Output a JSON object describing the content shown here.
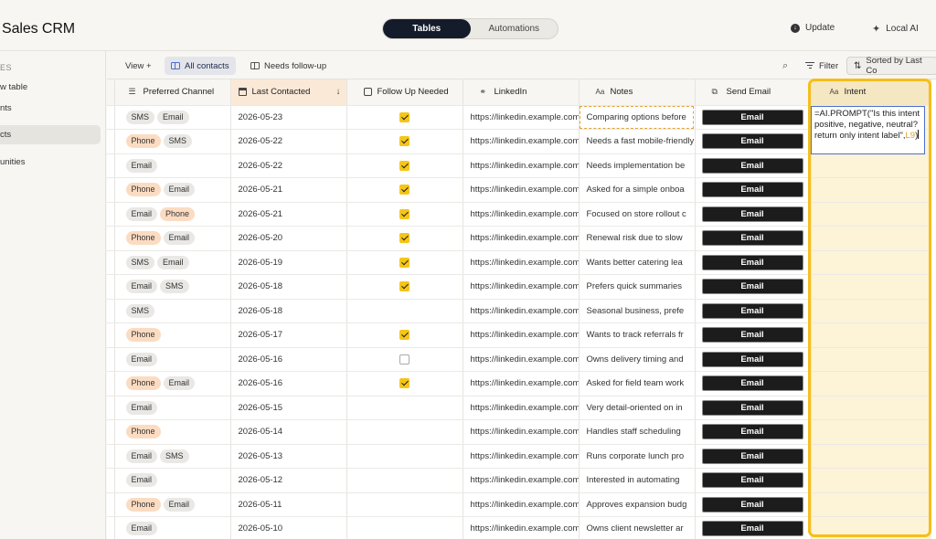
{
  "app": {
    "title": "Sales CRM"
  },
  "top": {
    "tabs": [
      "Tables",
      "Automations"
    ],
    "update_label": "Update",
    "local_ai_label": "Local AI"
  },
  "sidebar": {
    "section": "ES",
    "items": [
      {
        "label": "w table"
      },
      {
        "label": "nts"
      },
      {
        "label": "cts",
        "active": true
      },
      {
        "label": "unities"
      }
    ]
  },
  "toolbar": {
    "view_label": "View +",
    "all_contacts_label": "All contacts",
    "needs_followup_label": "Needs follow-up",
    "filter_label": "Filter",
    "sort_label": "Sorted by Last Co"
  },
  "columns": {
    "preferred_channel": "Preferred Channel",
    "last_contacted": "Last Contacted",
    "follow_up": "Follow Up Needed",
    "linkedin": "LinkedIn",
    "notes": "Notes",
    "send_email": "Send Email",
    "intent": "Intent"
  },
  "formula": {
    "text": "=AI.PROMPT(\"Is this intent positive, negative, neutral? return only intent label\",",
    "ref": "L9",
    "close": ")"
  },
  "email_label": "Email",
  "rows": [
    {
      "channels": [
        "SMS",
        "Email"
      ],
      "date": "2026-05-23",
      "follow": true,
      "linkedin": "https://linkedin.example.com",
      "notes": "Comparing options before"
    },
    {
      "channels": [
        "Phone",
        "SMS"
      ],
      "date": "2026-05-22",
      "follow": true,
      "linkedin": "https://linkedin.example.com",
      "notes": "Needs a fast mobile-friendly"
    },
    {
      "channels": [
        "Email"
      ],
      "date": "2026-05-22",
      "follow": true,
      "linkedin": "https://linkedin.example.com",
      "notes": "Needs implementation be"
    },
    {
      "channels": [
        "Phone",
        "Email"
      ],
      "date": "2026-05-21",
      "follow": true,
      "linkedin": "https://linkedin.example.com",
      "notes": "Asked for a simple onboa"
    },
    {
      "channels": [
        "Email",
        "Phone"
      ],
      "date": "2026-05-21",
      "follow": true,
      "linkedin": "https://linkedin.example.com",
      "notes": "Focused on store rollout c"
    },
    {
      "channels": [
        "Phone",
        "Email"
      ],
      "date": "2026-05-20",
      "follow": true,
      "linkedin": "https://linkedin.example.com",
      "notes": "Renewal risk due to slow"
    },
    {
      "channels": [
        "SMS",
        "Email"
      ],
      "date": "2026-05-19",
      "follow": true,
      "linkedin": "https://linkedin.example.com",
      "notes": "Wants better catering lea"
    },
    {
      "channels": [
        "Email",
        "SMS"
      ],
      "date": "2026-05-18",
      "follow": true,
      "linkedin": "https://linkedin.example.com",
      "notes": "Prefers quick summaries"
    },
    {
      "channels": [
        "SMS"
      ],
      "date": "2026-05-18",
      "follow": null,
      "linkedin": "https://linkedin.example.com",
      "notes": "Seasonal business, prefe"
    },
    {
      "channels": [
        "Phone"
      ],
      "date": "2026-05-17",
      "follow": true,
      "linkedin": "https://linkedin.example.com",
      "notes": "Wants to track referrals fr"
    },
    {
      "channels": [
        "Email"
      ],
      "date": "2026-05-16",
      "follow": false,
      "linkedin": "https://linkedin.example.com",
      "notes": "Owns delivery timing and"
    },
    {
      "channels": [
        "Phone",
        "Email"
      ],
      "date": "2026-05-16",
      "follow": true,
      "linkedin": "https://linkedin.example.com",
      "notes": "Asked for field team work"
    },
    {
      "channels": [
        "Email"
      ],
      "date": "2026-05-15",
      "follow": null,
      "linkedin": "https://linkedin.example.com",
      "notes": "Very detail-oriented on in"
    },
    {
      "channels": [
        "Phone"
      ],
      "date": "2026-05-14",
      "follow": null,
      "linkedin": "https://linkedin.example.com",
      "notes": "Handles staff scheduling"
    },
    {
      "channels": [
        "Email",
        "SMS"
      ],
      "date": "2026-05-13",
      "follow": null,
      "linkedin": "https://linkedin.example.com",
      "notes": "Runs corporate lunch pro"
    },
    {
      "channels": [
        "Email"
      ],
      "date": "2026-05-12",
      "follow": null,
      "linkedin": "https://linkedin.example.com",
      "notes": "Interested in automating"
    },
    {
      "channels": [
        "Phone",
        "Email"
      ],
      "date": "2026-05-11",
      "follow": null,
      "linkedin": "https://linkedin.example.com",
      "notes": "Approves expansion budg"
    },
    {
      "channels": [
        "Email"
      ],
      "date": "2026-05-10",
      "follow": null,
      "linkedin": "https://linkedin.example.com",
      "notes": "Owns client newsletter ar"
    }
  ]
}
